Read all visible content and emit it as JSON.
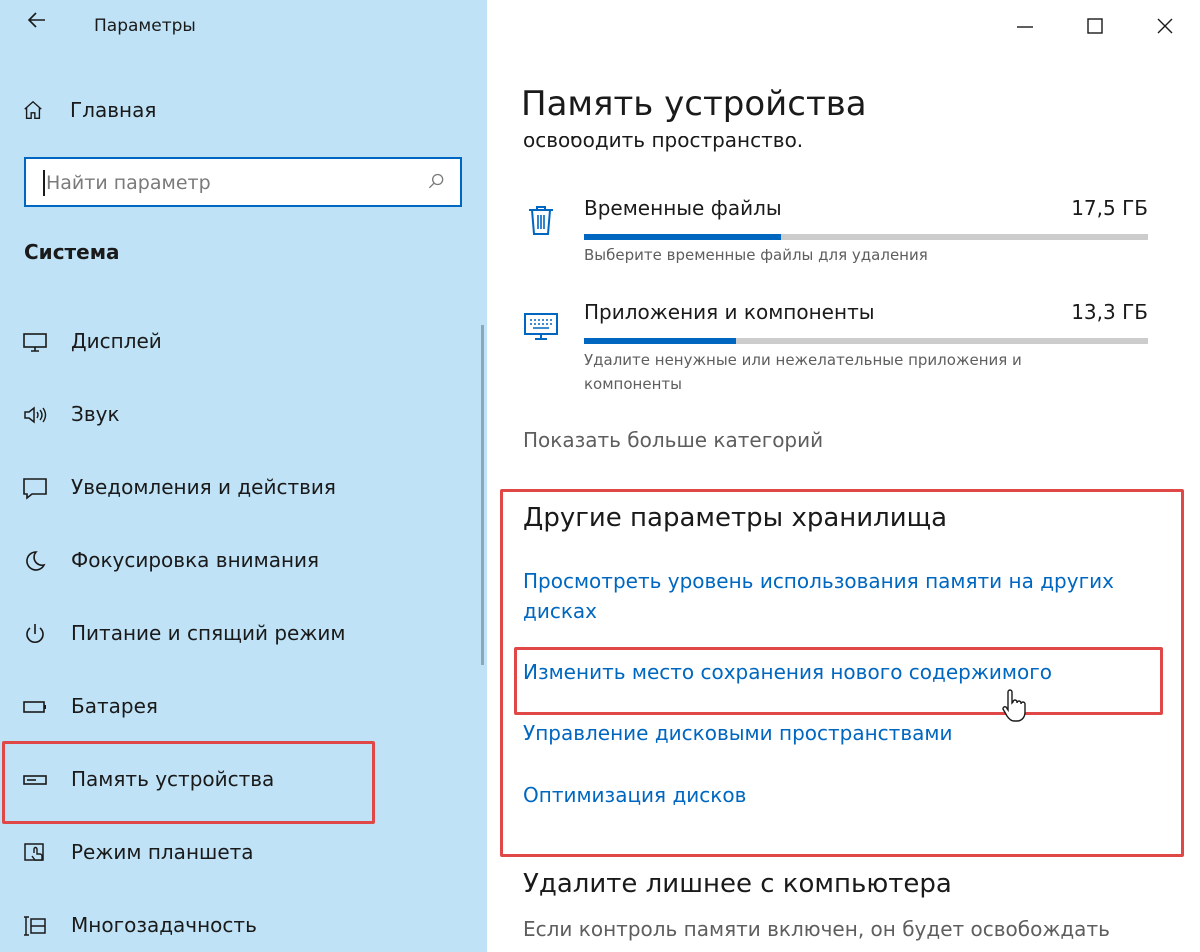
{
  "window": {
    "app_title": "Параметры",
    "back_icon": "back-arrow-icon",
    "controls": [
      "minimize-icon",
      "maximize-icon",
      "close-icon"
    ]
  },
  "sidebar": {
    "home_label": "Главная",
    "search_placeholder": "Найти параметр",
    "section_title": "Система",
    "items": [
      {
        "label": "Дисплей",
        "icon": "display-icon"
      },
      {
        "label": "Звук",
        "icon": "speaker-icon"
      },
      {
        "label": "Уведомления и действия",
        "icon": "notification-icon"
      },
      {
        "label": "Фокусировка внимания",
        "icon": "moon-icon"
      },
      {
        "label": "Питание и спящий режим",
        "icon": "power-icon"
      },
      {
        "label": "Батарея",
        "icon": "battery-icon"
      },
      {
        "label": "Память устройства",
        "icon": "storage-icon",
        "selected": true
      },
      {
        "label": "Режим планшета",
        "icon": "tablet-icon"
      },
      {
        "label": "Многозадачность",
        "icon": "multitask-icon"
      }
    ]
  },
  "main": {
    "page_title": "Память устройства",
    "cut_text": "освободить пространство.",
    "categories": [
      {
        "name": "Временные файлы",
        "size": "17,5 ГБ",
        "fraction": 0.35,
        "description": "Выберите временные файлы для удаления",
        "icon": "trash-icon"
      },
      {
        "name": "Приложения и компоненты",
        "size": "13,3 ГБ",
        "fraction": 0.27,
        "description": "Удалите ненужные или нежелательные приложения и компоненты",
        "icon": "apps-keyboard-icon"
      }
    ],
    "show_more": "Показать больше категорий",
    "other_title": "Другие параметры хранилища",
    "links": [
      "Просмотреть уровень использования памяти на других дисках",
      "Изменить место сохранения нового содержимого",
      "Управление дисковыми пространствами",
      "Оптимизация дисков"
    ],
    "cleanup_title": "Удалите лишнее с компьютера",
    "cleanup_text": "Если контроль памяти включен, он будет освобождать"
  },
  "colors": {
    "sidebar_bg": "#bfe2f6",
    "accent": "#0067c0",
    "highlight": "#e04848"
  }
}
